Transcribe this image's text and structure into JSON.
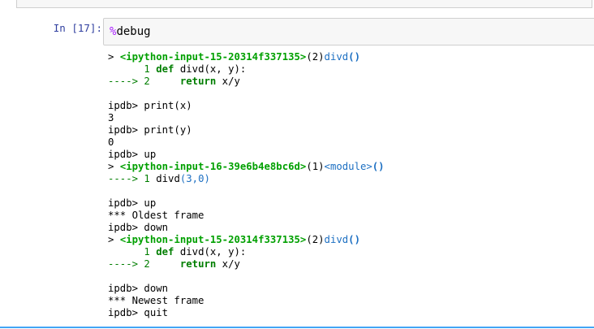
{
  "prompt": "In [17]:",
  "input": {
    "magic_symbol": "%",
    "magic_name": "debug"
  },
  "output": {
    "l1": {
      "a": "> ",
      "b": "<ipython-input-15-20314f337135>",
      "c": "(2)",
      "d": "divd",
      "e": "()"
    },
    "l2": {
      "a": "      1 ",
      "b": "def",
      "c": " divd",
      "d": "(x, y):"
    },
    "l3": {
      "a": "----> 2",
      "b": "     ",
      "c": "return",
      "d": " x/y"
    },
    "l5": "ipdb> print(x)",
    "l6": "3",
    "l7": "ipdb> print(y)",
    "l8": "0",
    "l9": "ipdb> up",
    "l10": {
      "a": "> ",
      "b": "<ipython-input-16-39e6b4e8bc6d>",
      "c": "(1)",
      "d": "<module>",
      "e": "()"
    },
    "l11": {
      "a": "----> 1",
      "b": " divd",
      "c": "(3,0)"
    },
    "l13": "ipdb> up",
    "l14": "*** Oldest frame",
    "l15": "ipdb> down",
    "l16": {
      "a": "> ",
      "b": "<ipython-input-15-20314f337135>",
      "c": "(2)",
      "d": "divd",
      "e": "()"
    },
    "l17": {
      "a": "      1 ",
      "b": "def",
      "c": " divd",
      "d": "(x, y):"
    },
    "l18": {
      "a": "----> 2",
      "b": "     ",
      "c": "return",
      "d": " x/y"
    },
    "l20": "ipdb> down",
    "l21": "*** Newest frame",
    "l22": "ipdb> quit"
  },
  "colors": {
    "prompt": "#303f9f",
    "magic": "#aa22ff",
    "path": "#00a000",
    "funcname": "#1c6fc2",
    "keyword": "#007e00",
    "selection_rule": "#42a5f5"
  }
}
